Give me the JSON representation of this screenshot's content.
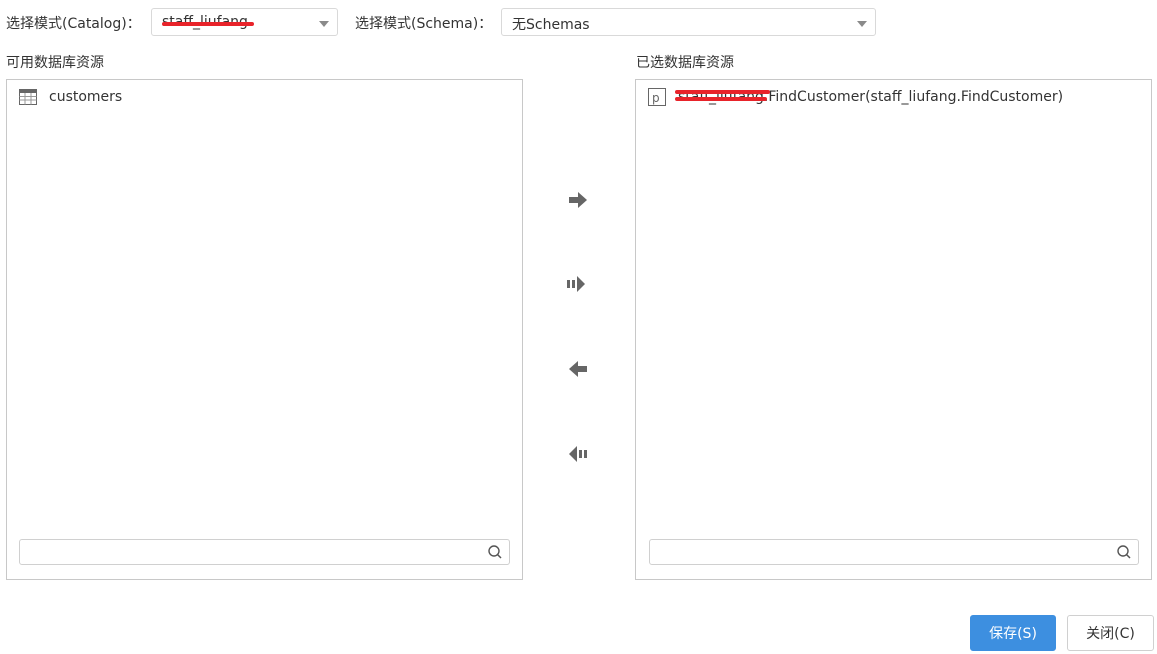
{
  "catalog": {
    "label": "选择模式(Catalog)：",
    "value": "staff_liufang"
  },
  "schema": {
    "label": "选择模式(Schema)：",
    "value": "无Schemas"
  },
  "available": {
    "title": "可用数据库资源",
    "items": [
      {
        "label": "customers",
        "icon": "table-icon"
      }
    ],
    "search_placeholder": ""
  },
  "selected": {
    "title": "已选数据库资源",
    "items": [
      {
        "label": "staff_liufang.FindCustomer(staff_liufang.FindCustomer)",
        "icon": "procedure-icon"
      }
    ],
    "search_placeholder": ""
  },
  "transfer": {
    "move_right": "arrow-right-icon",
    "move_all_right": "arrow-double-right-icon",
    "move_left": "arrow-left-icon",
    "move_all_left": "arrow-double-left-icon"
  },
  "buttons": {
    "save": "保存(S)",
    "close": "关闭(C)"
  },
  "colors": {
    "primary": "#3d8fe0",
    "redaction": "#e8232a",
    "border": "#c8c8c8"
  }
}
